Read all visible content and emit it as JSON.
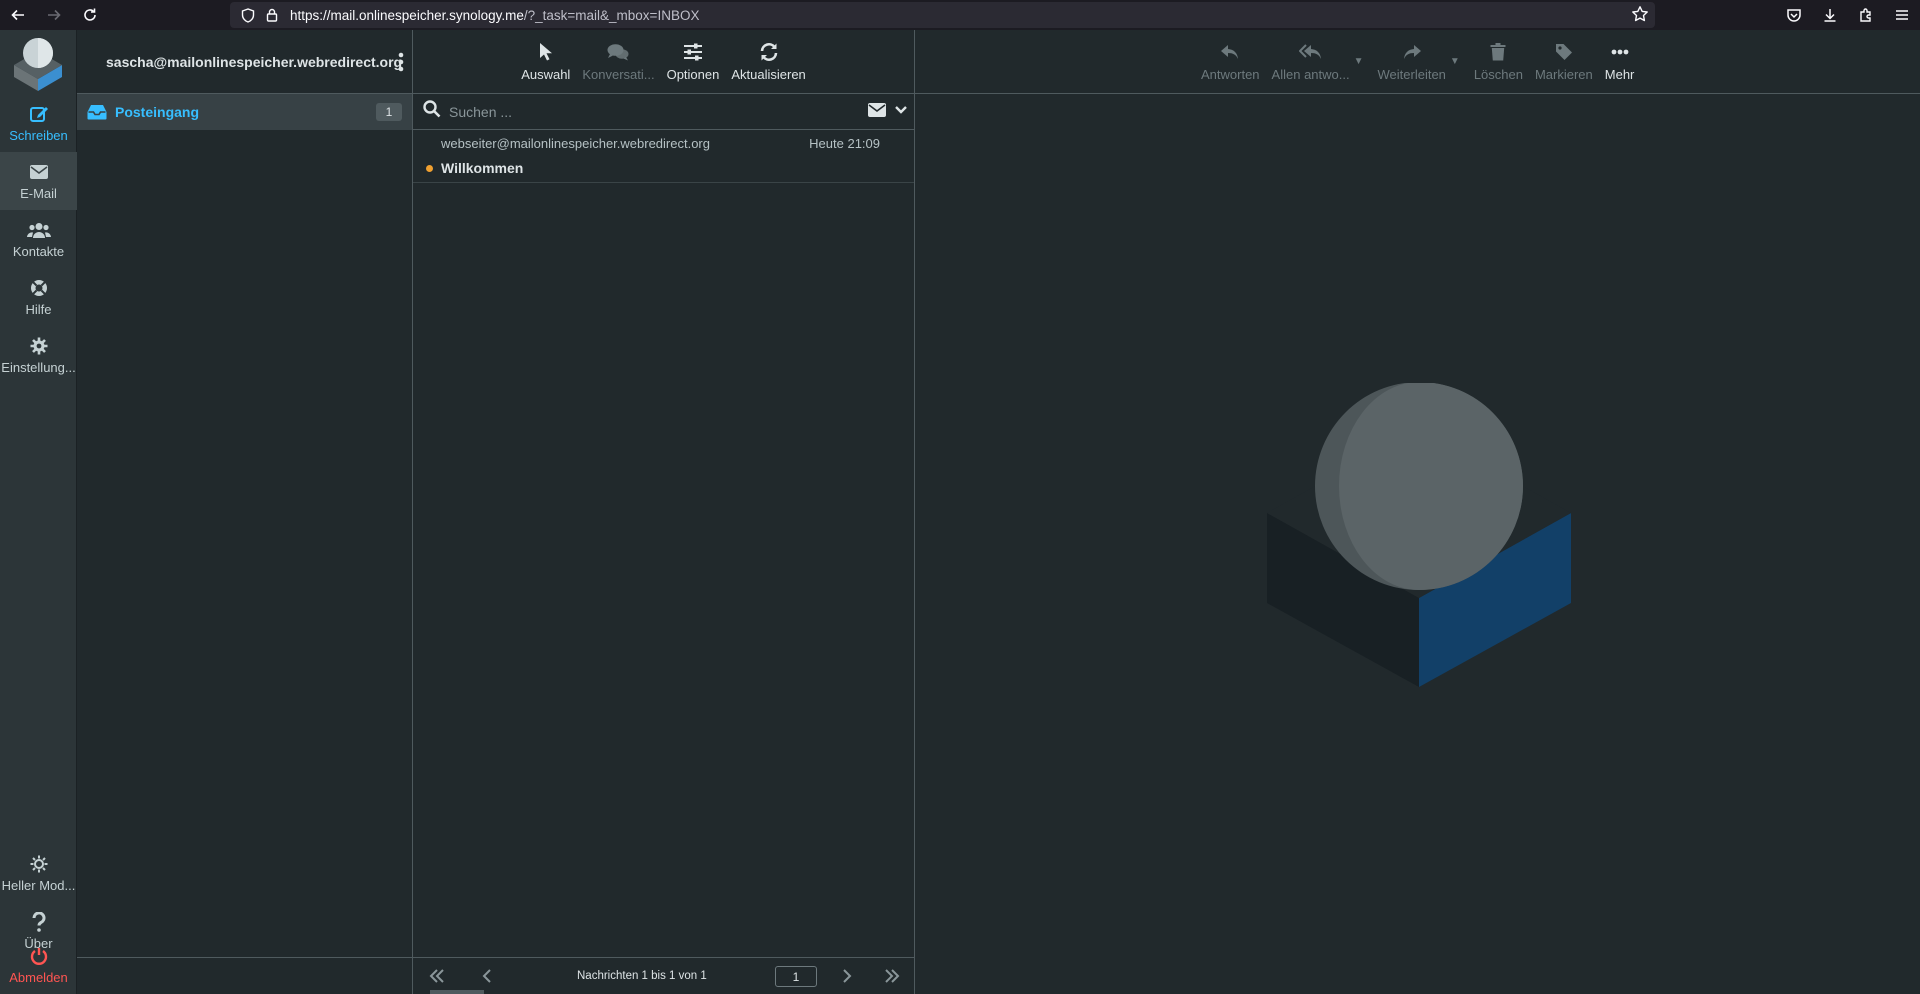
{
  "browser": {
    "url_host": "https://mail.onlinespeicher.synology.me",
    "url_path": "/?_task=mail&_mbox=INBOX"
  },
  "taskmenu": {
    "compose": "Schreiben",
    "mail": "E-Mail",
    "contacts": "Kontakte",
    "help": "Hilfe",
    "settings": "Einstellung...",
    "lightmode": "Heller Mod...",
    "about": "Über",
    "logout": "Abmelden"
  },
  "folders": {
    "account": "sascha@mailonlinespeicher.webredirect.org",
    "inbox_label": "Posteingang",
    "inbox_unread": "1"
  },
  "list_toolbar": {
    "select": "Auswahl",
    "threads": "Konversati...",
    "options": "Optionen",
    "refresh": "Aktualisieren"
  },
  "search": {
    "placeholder": "Suchen ..."
  },
  "messages": [
    {
      "from": "webseiter@mailonlinespeicher.webredirect.org",
      "date": "Heute 21:09",
      "subject": "Willkommen",
      "unread": true
    }
  ],
  "pagination": {
    "count": "Nachrichten 1 bis 1 von 1",
    "page": "1"
  },
  "message_toolbar": {
    "reply": "Antworten",
    "reply_all": "Allen antwo...",
    "forward": "Weiterleiten",
    "delete": "Löschen",
    "mark": "Markieren",
    "more": "Mehr"
  },
  "colors": {
    "accent": "#37beff",
    "logout": "#ff5552",
    "unread_dot": "#f0a030",
    "panel": "#21292c"
  }
}
